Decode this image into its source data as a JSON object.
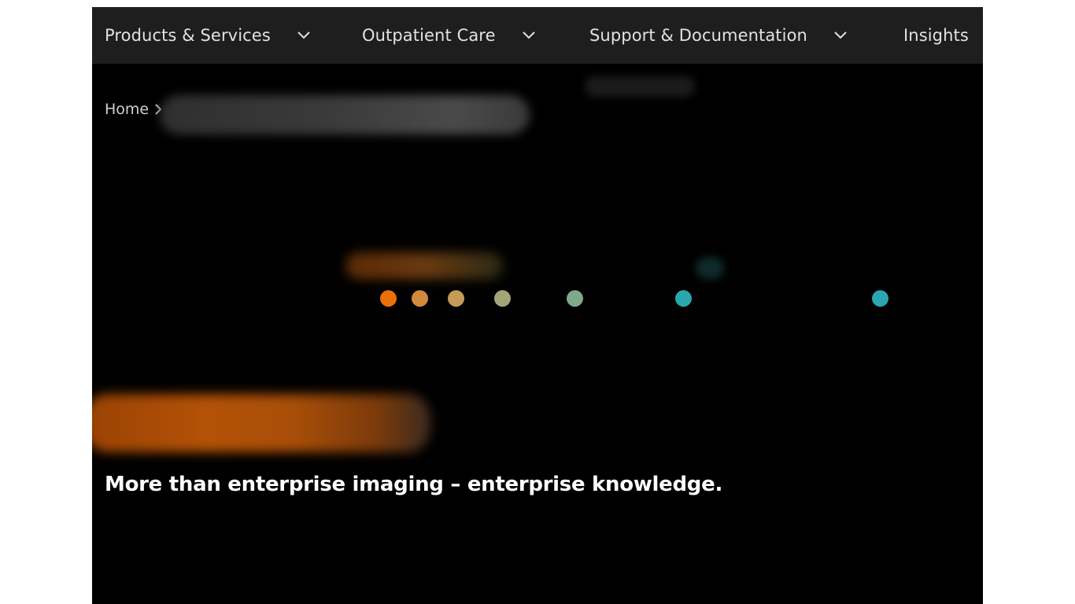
{
  "nav": {
    "items": [
      {
        "label": "Products & Services",
        "has_dropdown": true
      },
      {
        "label": "Outpatient Care",
        "has_dropdown": true
      },
      {
        "label": "Support & Documentation",
        "has_dropdown": true
      },
      {
        "label": "Insights",
        "has_dropdown": false
      }
    ]
  },
  "breadcrumb": {
    "home": "Home"
  },
  "hero": {
    "headline": "More than enterprise imaging – enterprise knowledge."
  },
  "colors": {
    "nav_bg": "#1e1e1e",
    "page_bg": "#000000",
    "dots": [
      "#ec6f08",
      "#d2893c",
      "#c49b57",
      "#a4a574",
      "#7fa98a",
      "#2aa7ab",
      "#2aa5b2"
    ]
  }
}
